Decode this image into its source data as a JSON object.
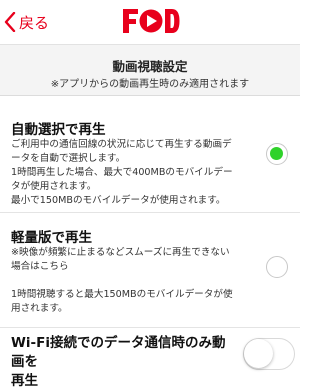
{
  "nav": {
    "back_label": "戻る",
    "logo_text": "FOD"
  },
  "settings": {
    "title": "動画視聴設定",
    "subtitle": "※アプリからの動画再生時のみ適用されます"
  },
  "options": [
    {
      "title": "自動選択で再生",
      "lines": [
        "ご利用中の通信回線の状況に応じて再生する動画デ",
        "ータを自動で選択します。",
        "1時間再生した場合、最大で400MBのモバイルデー",
        "タが使用されます。",
        "最小で150MBのモバイルデータが使用されます。"
      ],
      "selected": true
    },
    {
      "title": "軽量版で再生",
      "lines": [
        "※映像が頻繁に止まるなどスムーズに再生できない",
        "場合はこちら",
        "",
        "1時間視聴すると最大150MBのモバイルデータが使",
        "用されます。"
      ],
      "selected": false
    }
  ],
  "wifi": {
    "line1": "Wi-Fi接続でのデータ通信時のみ動画を",
    "line2": "再生",
    "enabled": false
  },
  "colors": {
    "accent": "#e8001c",
    "selected_radio": "#2fd22a",
    "header_bg": "#f4f4f4"
  }
}
